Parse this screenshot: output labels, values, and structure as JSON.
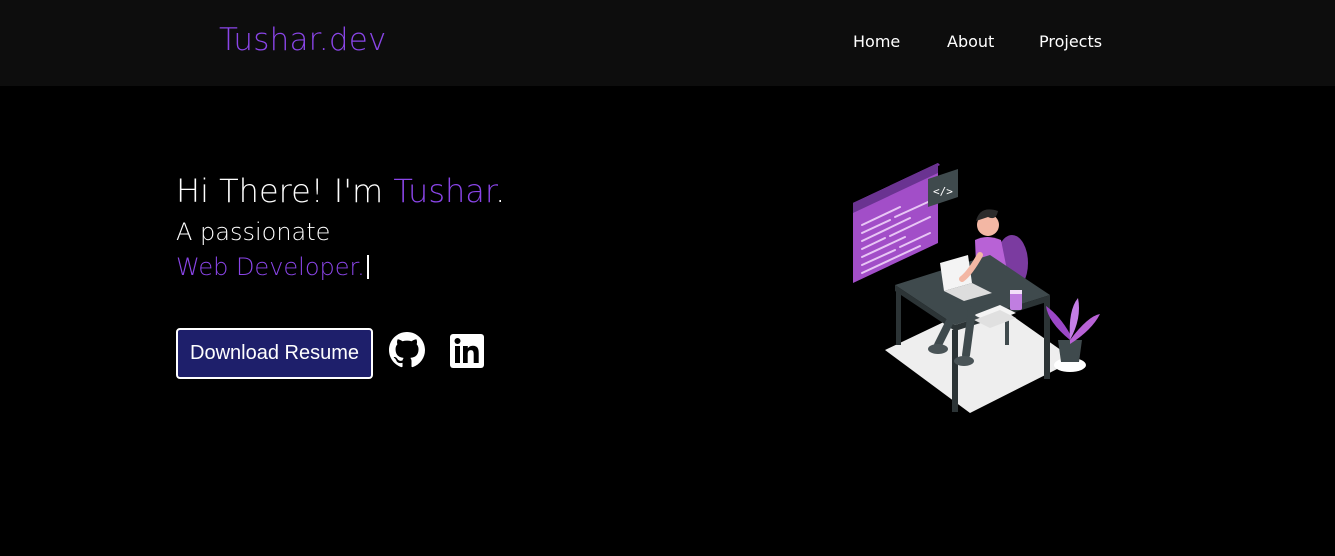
{
  "nav": {
    "brand": "Tushar.dev",
    "links": [
      "Home",
      "About",
      "Projects"
    ]
  },
  "hero": {
    "greeting": "Hi There! I'm ",
    "name": "Tushar",
    "period": ".",
    "subtitle": "A passionate",
    "role": "Web Developer."
  },
  "actions": {
    "resume_label": "Download Resume"
  },
  "icons": {
    "github": "github-icon",
    "linkedin": "linkedin-icon"
  },
  "colors": {
    "accent": "#8a45e8",
    "navbar_bg": "#0d0d0d",
    "page_bg": "#000000",
    "button_bg": "#1e1f6b"
  }
}
